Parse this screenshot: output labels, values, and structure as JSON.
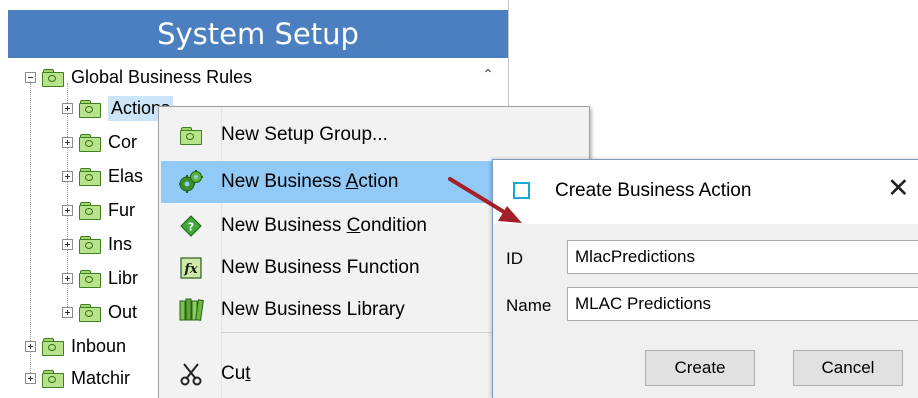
{
  "panel": {
    "title": "System Setup",
    "tree": {
      "root": "Global Business Rules",
      "children": [
        "Actions",
        "Cor",
        "Elas",
        "Fur",
        "Ins",
        "Libr",
        "Out"
      ],
      "siblings": [
        "Inboun",
        "Matchir"
      ]
    }
  },
  "context_menu": {
    "items": [
      {
        "label": "New Setup Group...",
        "icon": "setup-group-folder-icon"
      },
      {
        "label_pre": "New Business ",
        "label_u": "A",
        "label_post": "ction",
        "icon": "gears-icon",
        "highlighted": true
      },
      {
        "label_pre": "New Business ",
        "label_u": "C",
        "label_post": "ondition",
        "icon": "condition-diamond-icon"
      },
      {
        "label": "New Business Function",
        "icon": "function-fx-icon"
      },
      {
        "label": "New Business Library",
        "icon": "library-books-icon"
      },
      {
        "label_pre": "Cu",
        "label_u": "t",
        "label_post": "",
        "icon": "scissors-icon"
      }
    ]
  },
  "dialog": {
    "title": "Create Business Action",
    "close_glyph": "✕",
    "id_label": "ID",
    "id_value": "MlacPredictions",
    "name_label": "Name",
    "name_value": "MLAC Predictions",
    "create_label": "Create",
    "cancel_label": "Cancel"
  },
  "colors": {
    "header_bg": "#4b7fc0",
    "menu_highlight": "#91c9f7",
    "selection": "#cce4f7",
    "arrow": "#a4202a"
  }
}
